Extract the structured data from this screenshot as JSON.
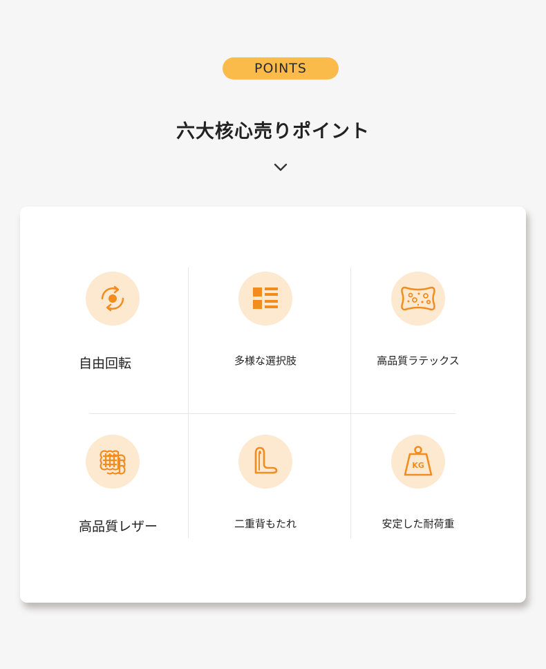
{
  "header": {
    "badge": "POINTS",
    "title": "六大核心売りポイント"
  },
  "features": [
    {
      "label": "自由回転",
      "icon": "rotate-icon"
    },
    {
      "label": "多様な選択肢",
      "icon": "grid-list-icon"
    },
    {
      "label": "高品質ラテックス",
      "icon": "sponge-icon"
    },
    {
      "label": "高品質レザー",
      "icon": "leather-texture-icon"
    },
    {
      "label": "二重背もたれ",
      "icon": "backrest-icon"
    },
    {
      "label": "安定した耐荷重",
      "icon": "weight-kg-icon"
    }
  ],
  "icon_text": {
    "weight": "KG"
  },
  "colors": {
    "background": "#f6f6f6",
    "badge": "#fbbb4a",
    "accent": "#f28c1e",
    "icon_circle": "#fde8d0",
    "card": "#ffffff"
  }
}
